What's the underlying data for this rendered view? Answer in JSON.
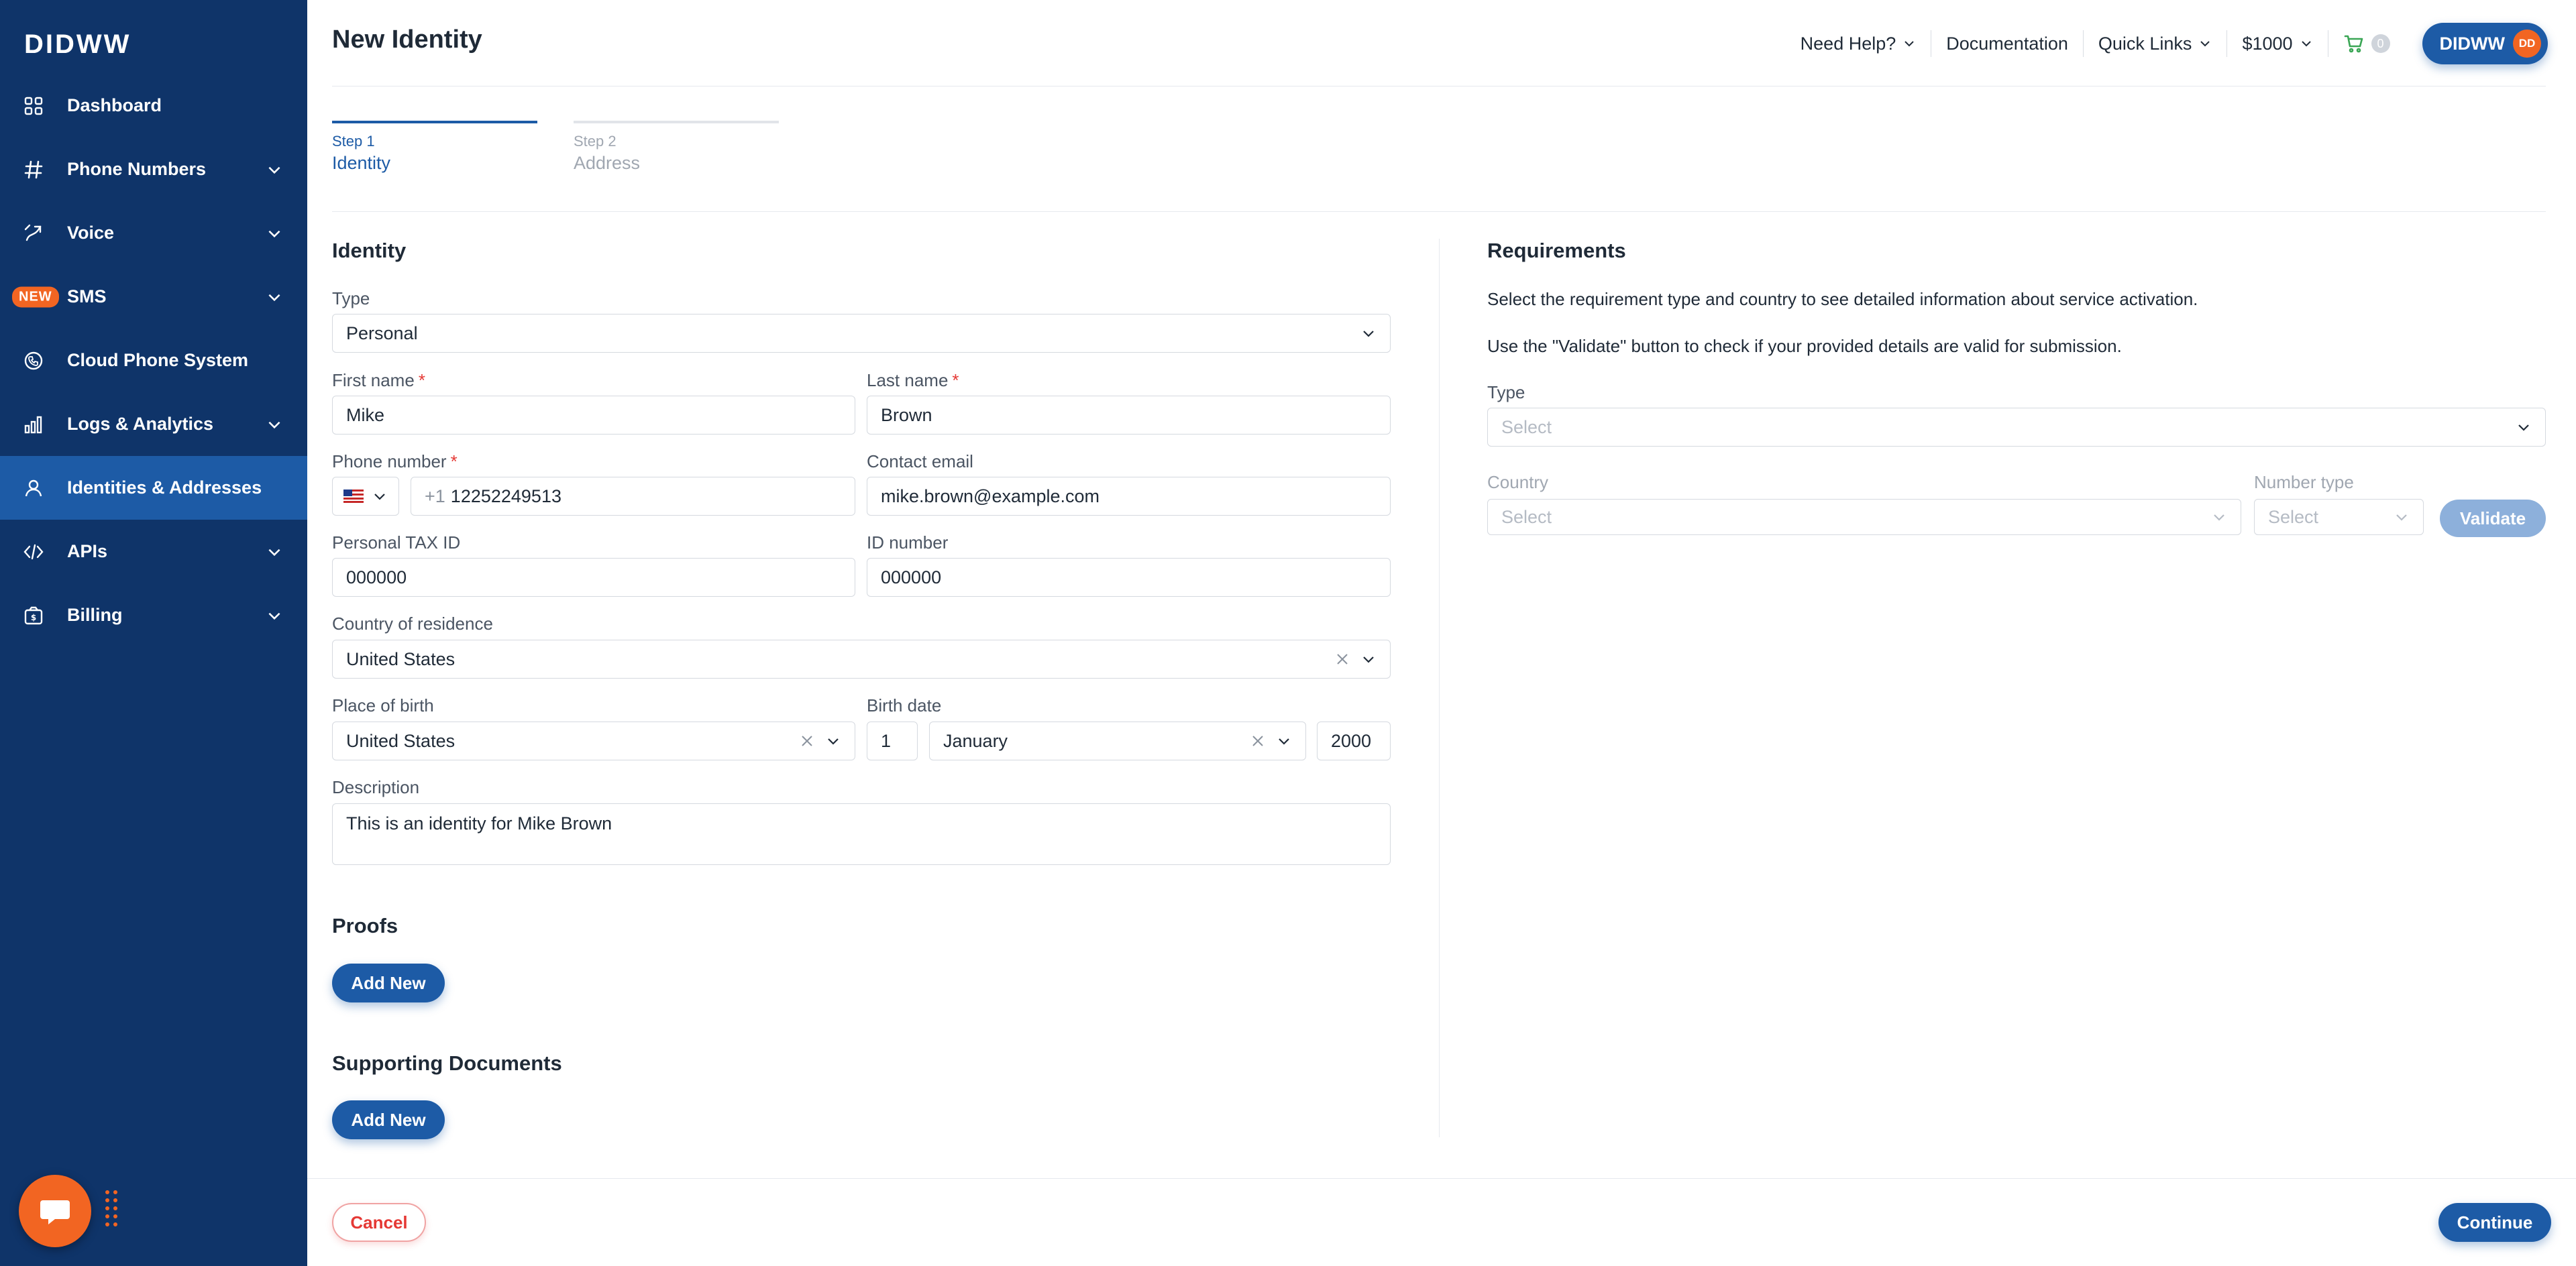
{
  "sidebar": {
    "logo": "DIDWW",
    "items": [
      {
        "label": "Dashboard",
        "icon": "dashboard-icon",
        "has_chevron": false
      },
      {
        "label": "Phone Numbers",
        "icon": "hash-icon",
        "has_chevron": true
      },
      {
        "label": "Voice",
        "icon": "voice-icon",
        "has_chevron": true
      },
      {
        "label": "SMS",
        "icon": "sms-icon",
        "has_chevron": true,
        "badge": "NEW"
      },
      {
        "label": "Cloud Phone System",
        "icon": "cloud-phone-icon",
        "has_chevron": false
      },
      {
        "label": "Logs & Analytics",
        "icon": "analytics-icon",
        "has_chevron": true
      },
      {
        "label": "Identities & Addresses",
        "icon": "user-icon",
        "has_chevron": false,
        "active": true
      },
      {
        "label": "APIs",
        "icon": "code-icon",
        "has_chevron": true
      },
      {
        "label": "Billing",
        "icon": "billing-icon",
        "has_chevron": true
      }
    ]
  },
  "header": {
    "title": "New Identity",
    "need_help": "Need Help?",
    "documentation": "Documentation",
    "quick_links": "Quick Links",
    "balance": "$1000",
    "cart_count": "0",
    "user_label": "DIDWW",
    "avatar_initials": "DD"
  },
  "steps": [
    {
      "num": "Step 1",
      "name": "Identity",
      "active": true
    },
    {
      "num": "Step 2",
      "name": "Address",
      "active": false
    }
  ],
  "identity": {
    "section_title": "Identity",
    "type_label": "Type",
    "type_value": "Personal",
    "first_name_label": "First name",
    "first_name_value": "Mike",
    "last_name_label": "Last name",
    "last_name_value": "Brown",
    "phone_label": "Phone number",
    "phone_prefix": "+1",
    "phone_value": "12252249513",
    "email_label": "Contact email",
    "email_value": "mike.brown@example.com",
    "tax_label": "Personal TAX ID",
    "tax_value": "000000",
    "id_label": "ID number",
    "id_value": "000000",
    "residence_label": "Country of residence",
    "residence_value": "United States",
    "birthplace_label": "Place of birth",
    "birthplace_value": "United States",
    "birthdate_label": "Birth date",
    "birth_day": "1",
    "birth_month": "January",
    "birth_year": "2000",
    "description_label": "Description",
    "description_value": "This is an identity for Mike Brown",
    "required_mark": "*"
  },
  "proofs": {
    "title": "Proofs",
    "add_label": "Add New"
  },
  "supporting": {
    "title": "Supporting Documents",
    "add_label": "Add New"
  },
  "requirements": {
    "title": "Requirements",
    "text1": "Select the requirement type and country to see detailed information about service activation.",
    "text2": "Use the \"Validate\" button to check if your provided details are valid for submission.",
    "type_label": "Type",
    "type_placeholder": "Select",
    "country_label": "Country",
    "country_placeholder": "Select",
    "number_type_label": "Number type",
    "number_type_placeholder": "Select",
    "validate_label": "Validate"
  },
  "footer": {
    "cancel_label": "Cancel",
    "continue_label": "Continue"
  },
  "colors": {
    "sidebar_bg": "#0f3469",
    "active_item": "#1d5ba6",
    "primary": "#1d5ba6",
    "accent": "#f26522",
    "danger": "#e53935"
  }
}
